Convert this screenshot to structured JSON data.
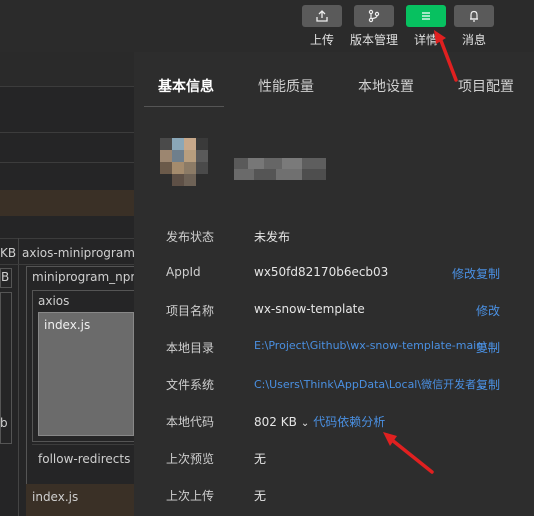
{
  "toolbar": {
    "upload_label": "上传",
    "version_label": "版本管理",
    "details_label": "详情",
    "messages_label": "消息"
  },
  "left_panel": {
    "kb_label": "KB",
    "b_label": "B",
    "axios_miniprogram_label": "axios-miniprogram-a",
    "miniprogram_npm_label": "miniprogram_npm",
    "axios_label": "axios",
    "index_js_label": "index.js",
    "b_edge_label": "b",
    "follow_redirects_label": "follow-redirects",
    "index_js_bottom_label": "index.js"
  },
  "tabs": [
    {
      "label": "基本信息",
      "active": true
    },
    {
      "label": "性能质量",
      "active": false
    },
    {
      "label": "本地设置",
      "active": false
    },
    {
      "label": "项目配置",
      "active": false
    }
  ],
  "info": {
    "publish_status": {
      "label": "发布状态",
      "value": "未发布"
    },
    "appid": {
      "label": "AppId",
      "value": "wx50fd82170b6ecb03",
      "action_modify": "修改",
      "action_copy": "复制"
    },
    "project_name": {
      "label": "项目名称",
      "value": "wx-snow-template",
      "action_modify": "修改"
    },
    "local_dir": {
      "label": "本地目录",
      "value": "E:\\Project\\Github\\wx-snow-template-main\\...",
      "action_copy": "复制"
    },
    "file_system": {
      "label": "文件系统",
      "value": "C:\\Users\\Think\\AppData\\Local\\微信开发者...",
      "action_copy": "复制"
    },
    "local_code": {
      "label": "本地代码",
      "value": "802 KB",
      "dep_analysis": "代码依赖分析"
    },
    "last_preview": {
      "label": "上次预览",
      "value": "无"
    },
    "last_upload": {
      "label": "上次上传",
      "value": "无"
    }
  },
  "colors": {
    "accent_green": "#07c160",
    "link_blue": "#4a90e2",
    "annotation_red": "#e02020"
  }
}
